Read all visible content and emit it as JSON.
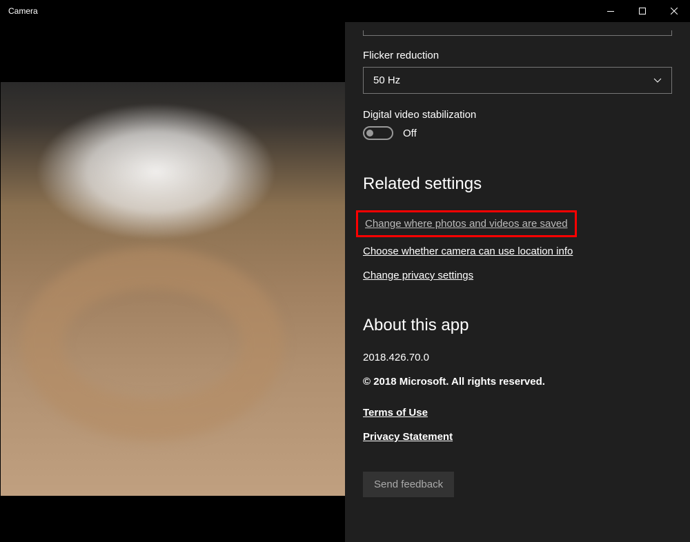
{
  "window": {
    "title": "Camera"
  },
  "settings": {
    "flicker_label": "Flicker reduction",
    "flicker_value": "50 Hz",
    "stabilization_label": "Digital video stabilization",
    "stabilization_state": "Off"
  },
  "related": {
    "heading": "Related settings",
    "link_save_location": "Change where photos and videos are saved",
    "link_location_info": "Choose whether camera can use location info",
    "link_privacy": "Change privacy settings"
  },
  "about": {
    "heading": "About this app",
    "version": "2018.426.70.0",
    "copyright": "© 2018 Microsoft. All rights reserved.",
    "terms_link": "Terms of Use",
    "privacy_link": "Privacy Statement",
    "feedback_button": "Send feedback"
  }
}
